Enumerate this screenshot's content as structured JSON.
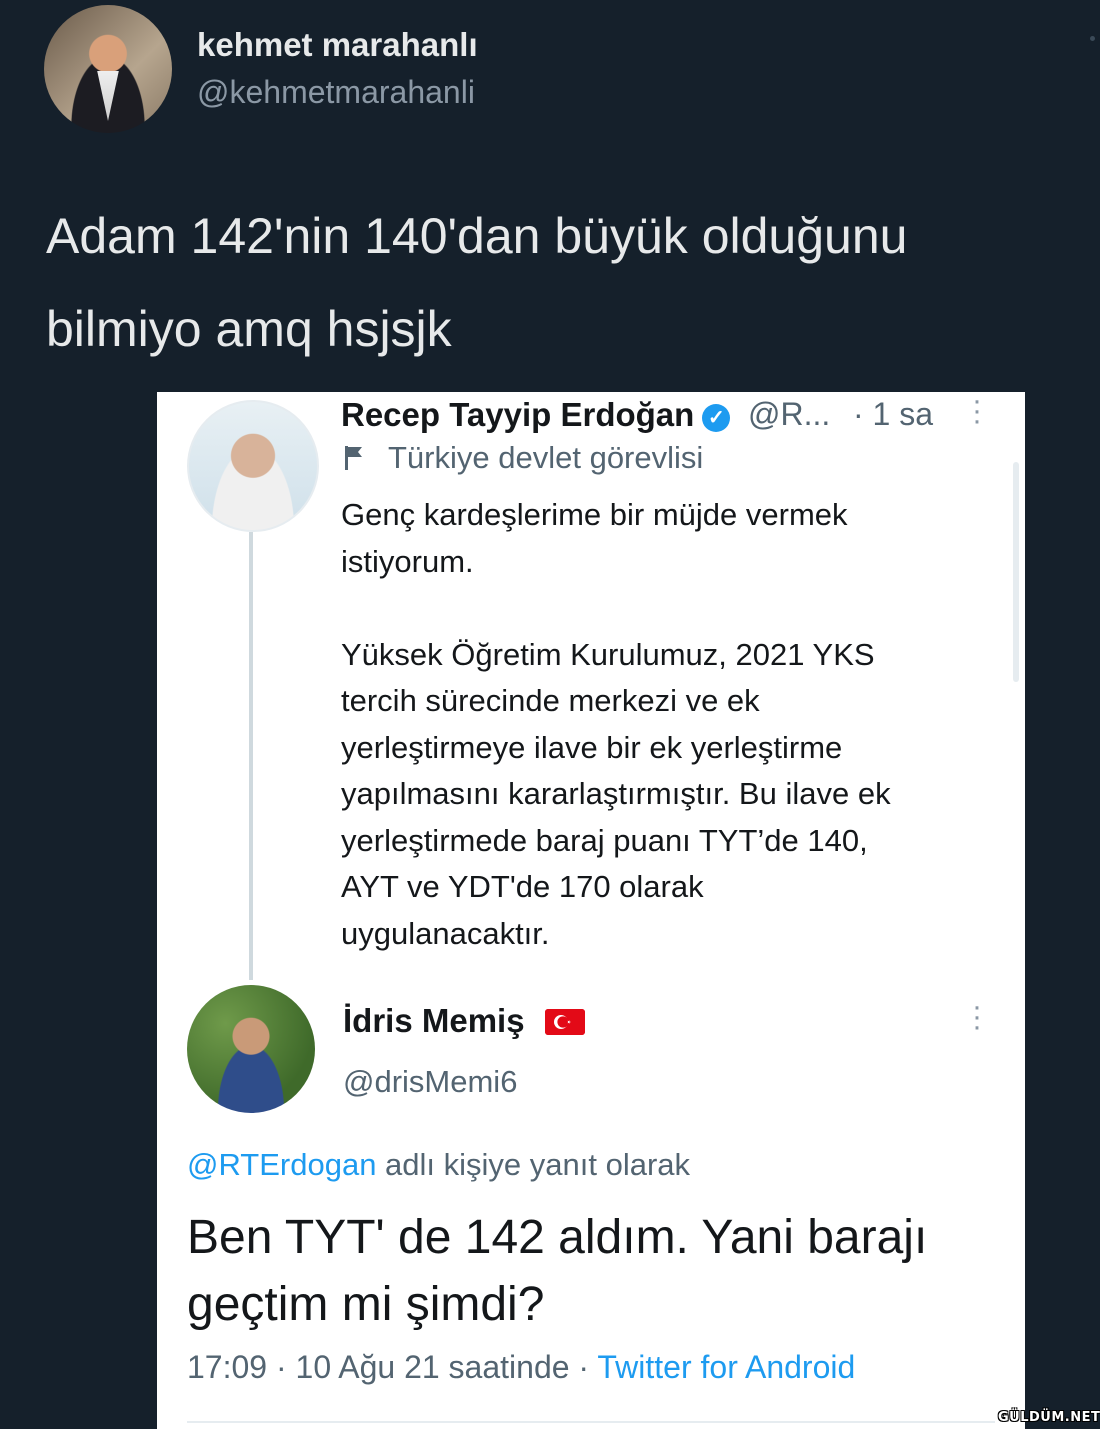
{
  "outer_tweet": {
    "name": "kehmet marahanlı",
    "handle": "@kehmetmarahanli",
    "text": "Adam 142'nin 140'dan büyük olduğunu bilmiyo amq hsjsjk"
  },
  "screenshot": {
    "tweet1": {
      "name": "Recep Tayyip Erdoğan",
      "handle": "@R...",
      "time": "· 1 sa",
      "label": "Türkiye devlet görevlisi",
      "text": "Genç kardeşlerime bir müjde vermek\nistiyorum.\n\nYüksek Öğretim Kurulumuz, 2021 YKS\ntercih sürecinde merkezi ve ek\nyerleştirmeye ilave bir ek yerleştirme\nyapılmasını kararlaştırmıştır. Bu ilave ek\nyerleştirmede baraj puanı TYT’de 140,\nAYT ve YDT'de 170 olarak\nuygulanacaktır."
    },
    "tweet2": {
      "name": "İdris Memiş",
      "handle": "@drisMemi6",
      "reply_to_user": "@RTErdogan",
      "reply_to_suffix": " adlı kişiye yanıt olarak",
      "text": "Ben TYT' de 142 aldım. Yani barajı geçtim mi şimdi?",
      "timestamp": "17:09 · 10 Ağu 21 saatinde · ",
      "source": "Twitter for Android"
    }
  },
  "watermark": "GÜLDÜM.NET",
  "colors": {
    "background": "#15202b",
    "link": "#1d9bf0",
    "verified": "#1d9bf0",
    "flag_red": "#e30a17"
  }
}
